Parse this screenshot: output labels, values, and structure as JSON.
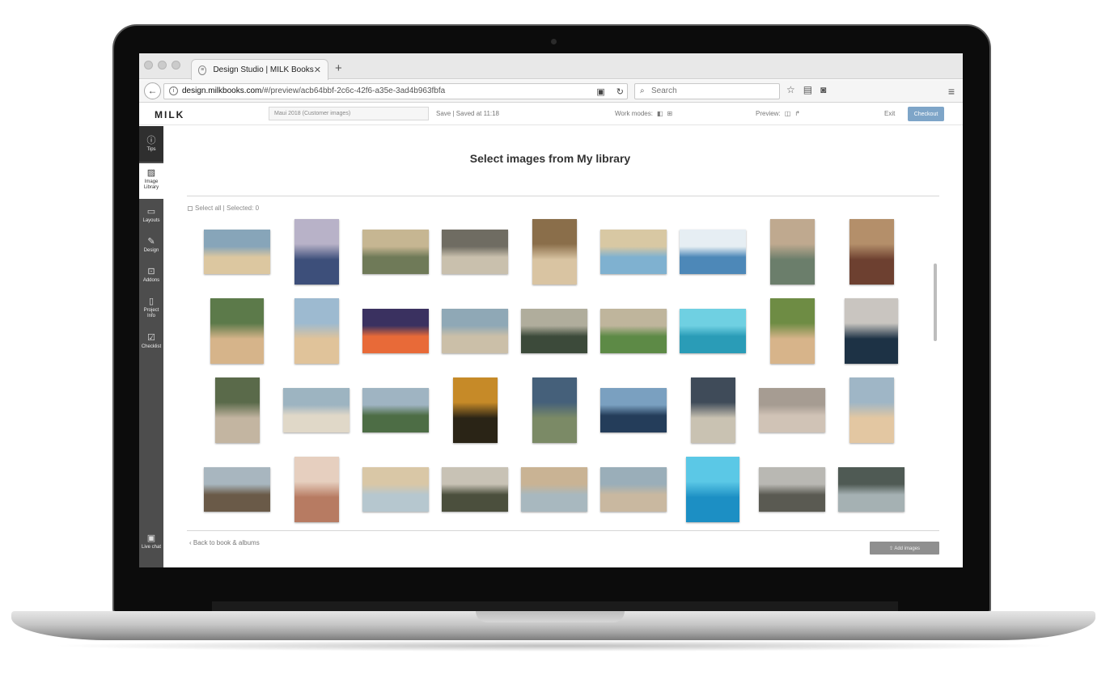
{
  "browser": {
    "tab_title": "Design Studio | MILK Books",
    "tab_close": "✕",
    "new_tab": "+",
    "url_domain": "design.milkbooks.com",
    "url_path": "/#/preview/acb64bbf-2c6c-42f6-a35e-3ad4b963fbfa",
    "search_placeholder": "Search"
  },
  "header": {
    "logo": "MILK",
    "project_name": "Maui 2018 (Customer images)",
    "save_label": "Save",
    "saved_status": "Saved at 11:18",
    "work_modes_label": "Work modes:",
    "preview_label": "Preview:",
    "exit_label": "Exit",
    "checkout_label": "Checkout"
  },
  "sidebar": {
    "items": [
      {
        "label": "Tips",
        "icon": "info-icon"
      },
      {
        "label": "Image Library",
        "icon": "image-icon"
      },
      {
        "label": "Layouts",
        "icon": "layout-icon"
      },
      {
        "label": "Design",
        "icon": "pencil-icon"
      },
      {
        "label": "Addons",
        "icon": "addon-icon"
      },
      {
        "label": "Project Info",
        "icon": "document-icon"
      },
      {
        "label": "Checklist",
        "icon": "checklist-icon"
      }
    ],
    "live_chat": "Live chat"
  },
  "main": {
    "title": "Select images from My library",
    "select_all": "Select all | Selected: 0",
    "back_link": "Back to book & albums",
    "add_images": "Add images"
  },
  "colors": {
    "checkout": "#7ea5c8",
    "sidebar_bg": "#4d4d4d",
    "add_button": "#8f8f8f"
  }
}
